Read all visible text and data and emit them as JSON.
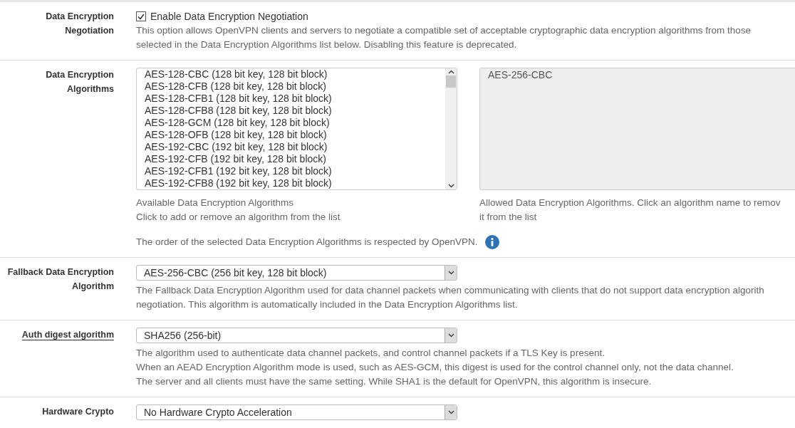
{
  "rows": [
    {
      "kind": "checkbox",
      "label": "Data Encryption Negotiation",
      "has_help": false,
      "checkbox": {
        "label": "Enable Data Encryption Negotiation",
        "checked": true
      },
      "help_lines": [
        "This option allows OpenVPN clients and servers to negotiate a compatible set of acceptable cryptographic data encryption algorithms from those",
        "selected in the Data Encryption Algorithms list below. Disabling this feature is deprecated."
      ]
    },
    {
      "kind": "dual_list",
      "label": "Data Encryption Algorithms",
      "has_help": false,
      "available": {
        "items": [
          "AES-128-CBC (128 bit key, 128 bit block)",
          "AES-128-CFB (128 bit key, 128 bit block)",
          "AES-128-CFB1 (128 bit key, 128 bit block)",
          "AES-128-CFB8 (128 bit key, 128 bit block)",
          "AES-128-GCM (128 bit key, 128 bit block)",
          "AES-128-OFB (128 bit key, 128 bit block)",
          "AES-192-CBC (192 bit key, 128 bit block)",
          "AES-192-CFB (192 bit key, 128 bit block)",
          "AES-192-CFB1 (192 bit key, 128 bit block)",
          "AES-192-CFB8 (192 bit key, 128 bit block)"
        ],
        "help_lines": [
          "Available Data Encryption Algorithms",
          "Click to add or remove an algorithm from the list"
        ]
      },
      "allowed": {
        "items": [
          "AES-256-CBC"
        ],
        "help_lines": [
          "Allowed Data Encryption Algorithms. Click an algorithm name to remov",
          "it from the list"
        ]
      },
      "note": "The order of the selected Data Encryption Algorithms is respected by OpenVPN."
    },
    {
      "kind": "select",
      "label": "Fallback Data Encryption Algorithm",
      "has_help": false,
      "value": "AES-256-CBC (256 bit key, 128 bit block)",
      "help_lines": [
        "The Fallback Data Encryption Algorithm used for data channel packets when communicating with clients that do not support data encryption algorith",
        "negotiation. This algorithm is automatically included in the Data Encryption Algorithms list."
      ]
    },
    {
      "kind": "select",
      "label": "Auth digest algorithm",
      "has_help": true,
      "value": "SHA256 (256-bit)",
      "help_lines": [
        "The algorithm used to authenticate data channel packets, and control channel packets if a TLS Key is present.",
        "When an AEAD Encryption Algorithm mode is used, such as AES-GCM, this digest is used for the control channel only, not the data channel.",
        "The server and all clients must have the same setting. While SHA1 is the default for OpenVPN, this algorithm is insecure."
      ]
    },
    {
      "kind": "select",
      "label": "Hardware Crypto",
      "has_help": false,
      "value": "No Hardware Crypto Acceleration"
    }
  ]
}
